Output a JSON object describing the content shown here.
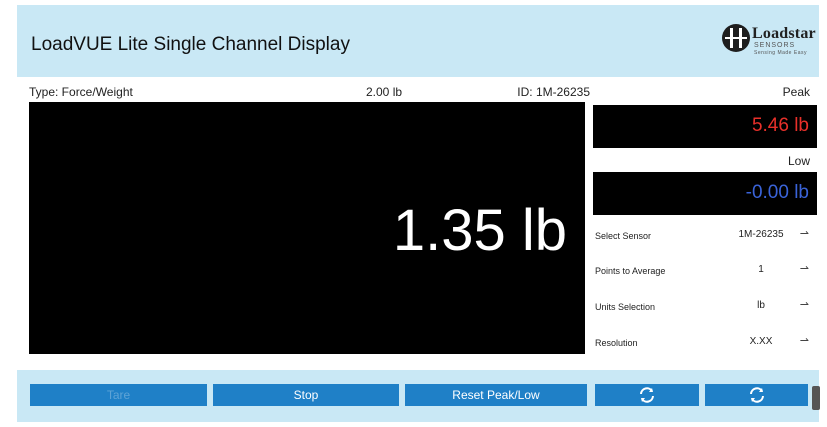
{
  "app": {
    "title": "LoadVUE Lite Single Channel Display",
    "logo": {
      "name": "Loadstar",
      "sub": "SENSORS",
      "tagline": "Sensing Made Easy"
    }
  },
  "info": {
    "type": "Type: Force/Weight",
    "capacity": "2.00 lb",
    "id": "ID: 1M-26235"
  },
  "reading": "1.35 lb",
  "peak": {
    "label": "Peak",
    "value": "5.46 lb",
    "color": "#e8302a"
  },
  "low": {
    "label": "Low",
    "value": "-0.00 lb",
    "color": "#3a63d8"
  },
  "settings": [
    {
      "label": "Select Sensor",
      "value": "1M-26235"
    },
    {
      "label": "Points to Average",
      "value": "1"
    },
    {
      "label": "Units Selection",
      "value": "lb"
    },
    {
      "label": "Resolution",
      "value": "X.XX"
    }
  ],
  "buttons": {
    "tare": "Tare",
    "stop": "Stop",
    "reset": "Reset Peak/Low"
  },
  "colors": {
    "accent": "#1f80c7",
    "header_bg": "#c9e8f5"
  },
  "icons": {
    "refresh": "refresh-icon",
    "dropdown": "dropdown-arrow-icon"
  }
}
